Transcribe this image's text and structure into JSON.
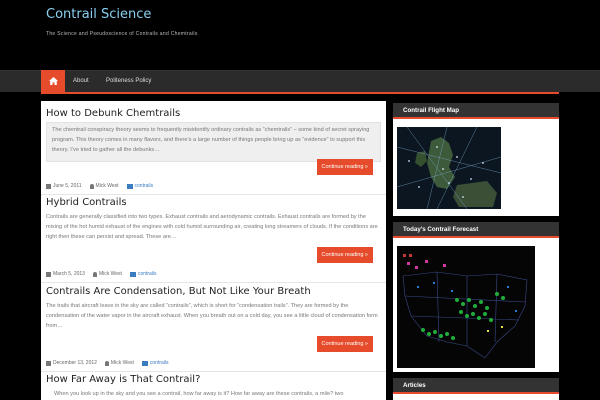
{
  "site": {
    "title": "Contrail Science",
    "tagline": "The Science and Pseudoscience of Contrails and Chemtrails"
  },
  "nav": {
    "home_icon": "home-icon",
    "items": [
      "About",
      "Politeness Policy"
    ]
  },
  "posts": [
    {
      "title": "How to Debunk Chemtrails",
      "excerpt": "The chemtrail conspiracy theory seems to frequently misidentify ordinary contrails as “chemtrails” – some kind of secret spraying program. This theory comes in many flavors, and there’s a large number of things people bring up as “evidence” to support this theory. I’ve tried to gather all the debunks…",
      "button": "Continue reading »",
      "date": "June 5, 2011",
      "author": "Mick West",
      "category": "contrails"
    },
    {
      "title": "Hybrid Contrails",
      "excerpt": "Contrails are generally classified into two types. Exhaust contrails and aerodynamic contrails. Exhaust contrails are formed by the mixing of the hot humid exhaust of the engines with cold humid surrounding air, creating long streamers of clouds. If the conditions are right then these can persist and spread. These are…",
      "button": "Continue reading »",
      "date": "March 5, 2013",
      "author": "Mick West",
      "category": "contrails"
    },
    {
      "title": "Contrails Are Condensation, But Not Like Your Breath",
      "excerpt": "The trails that aircraft leave in the sky are called “contrails”, which is short for “condensation trails”. They are formed by the condensation of the water vapor in the aircraft exhaust. When you breath out on a cold day, you see a little cloud of condensation form from…",
      "button": "Continue reading »",
      "date": "December 13, 2012",
      "author": "Mick West",
      "category": "contrails"
    },
    {
      "title": "How Far Away is That Contrail?",
      "excerpt": "When you look up in the sky and you see a contrail, how far away is it? How far away are these contrails, a mile? two"
    }
  ],
  "sidebar": {
    "widgets": [
      "Contrail Flight Map",
      "Today’s Contrail Forecast",
      "Articles"
    ]
  },
  "colors": {
    "accent": "#e64b2c",
    "title": "#8ad0f0",
    "link": "#3a7cc0"
  }
}
